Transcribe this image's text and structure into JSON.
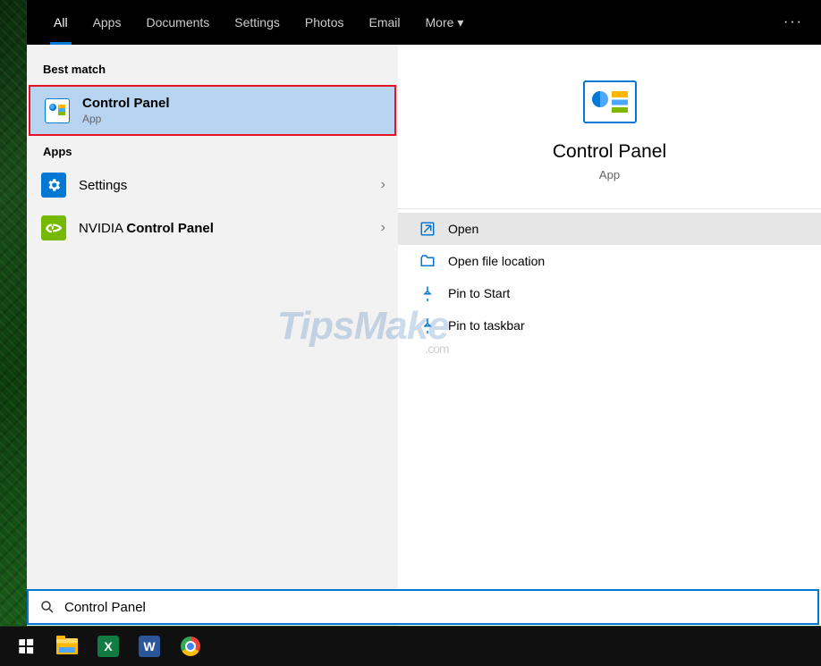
{
  "tabs": {
    "all": "All",
    "apps": "Apps",
    "documents": "Documents",
    "settings": "Settings",
    "photos": "Photos",
    "email": "Email",
    "more": "More"
  },
  "sections": {
    "best_match": "Best match",
    "apps": "Apps"
  },
  "results": {
    "best": {
      "title": "Control Panel",
      "subtitle": "App"
    },
    "settings": {
      "title": "Settings"
    },
    "nvidia": {
      "prefix": "NVIDIA ",
      "bold": "Control Panel"
    }
  },
  "preview": {
    "title": "Control Panel",
    "subtitle": "App"
  },
  "actions": {
    "open": "Open",
    "open_location": "Open file location",
    "pin_start": "Pin to Start",
    "pin_taskbar": "Pin to taskbar"
  },
  "search": {
    "value": "Control Panel"
  },
  "watermark": {
    "main": "TipsMake",
    "sub": ".com"
  },
  "taskbar": {
    "excel_letter": "X",
    "word_letter": "W"
  }
}
